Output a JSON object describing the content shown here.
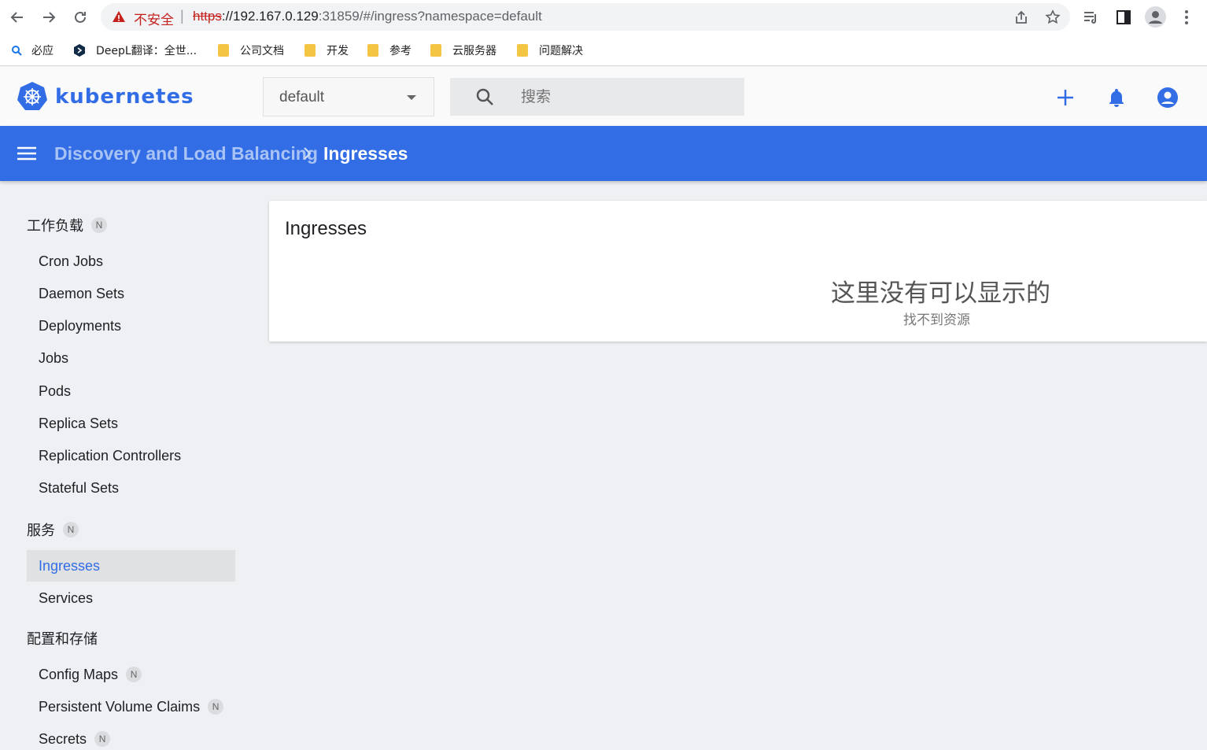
{
  "browser": {
    "insecure_label": "不安全",
    "separator": "|",
    "url_scheme": "https",
    "url_host": "://192.167.0.129",
    "url_rest": ":31859/#/ingress?namespace=default"
  },
  "bookmarks": [
    {
      "label": "必应"
    },
    {
      "label": "DeepL翻译：全世..."
    },
    {
      "label": "公司文档"
    },
    {
      "label": "开发"
    },
    {
      "label": "参考"
    },
    {
      "label": "云服务器"
    },
    {
      "label": "问题解决"
    }
  ],
  "header": {
    "brand": "kubernetes",
    "namespace": "default",
    "search_placeholder": "搜索"
  },
  "breadcrumb": {
    "parent": "Discovery and Load Balancing",
    "current": "Ingresses"
  },
  "sidebar": {
    "workloads": {
      "title": "工作负载",
      "badge": "N",
      "items": [
        "Cron Jobs",
        "Daemon Sets",
        "Deployments",
        "Jobs",
        "Pods",
        "Replica Sets",
        "Replication Controllers",
        "Stateful Sets"
      ]
    },
    "services": {
      "title": "服务",
      "badge": "N",
      "items": [
        "Ingresses",
        "Services"
      ]
    },
    "config": {
      "title": "配置和存储",
      "items": [
        {
          "label": "Config Maps",
          "badge": "N"
        },
        {
          "label": "Persistent Volume Claims",
          "badge": "N"
        },
        {
          "label": "Secrets",
          "badge": "N"
        }
      ]
    }
  },
  "main": {
    "card_title": "Ingresses",
    "empty_title": "这里没有可以显示的",
    "empty_subtitle": "找不到资源"
  },
  "colors": {
    "accent": "#326de6",
    "insecure": "#c5221f"
  }
}
